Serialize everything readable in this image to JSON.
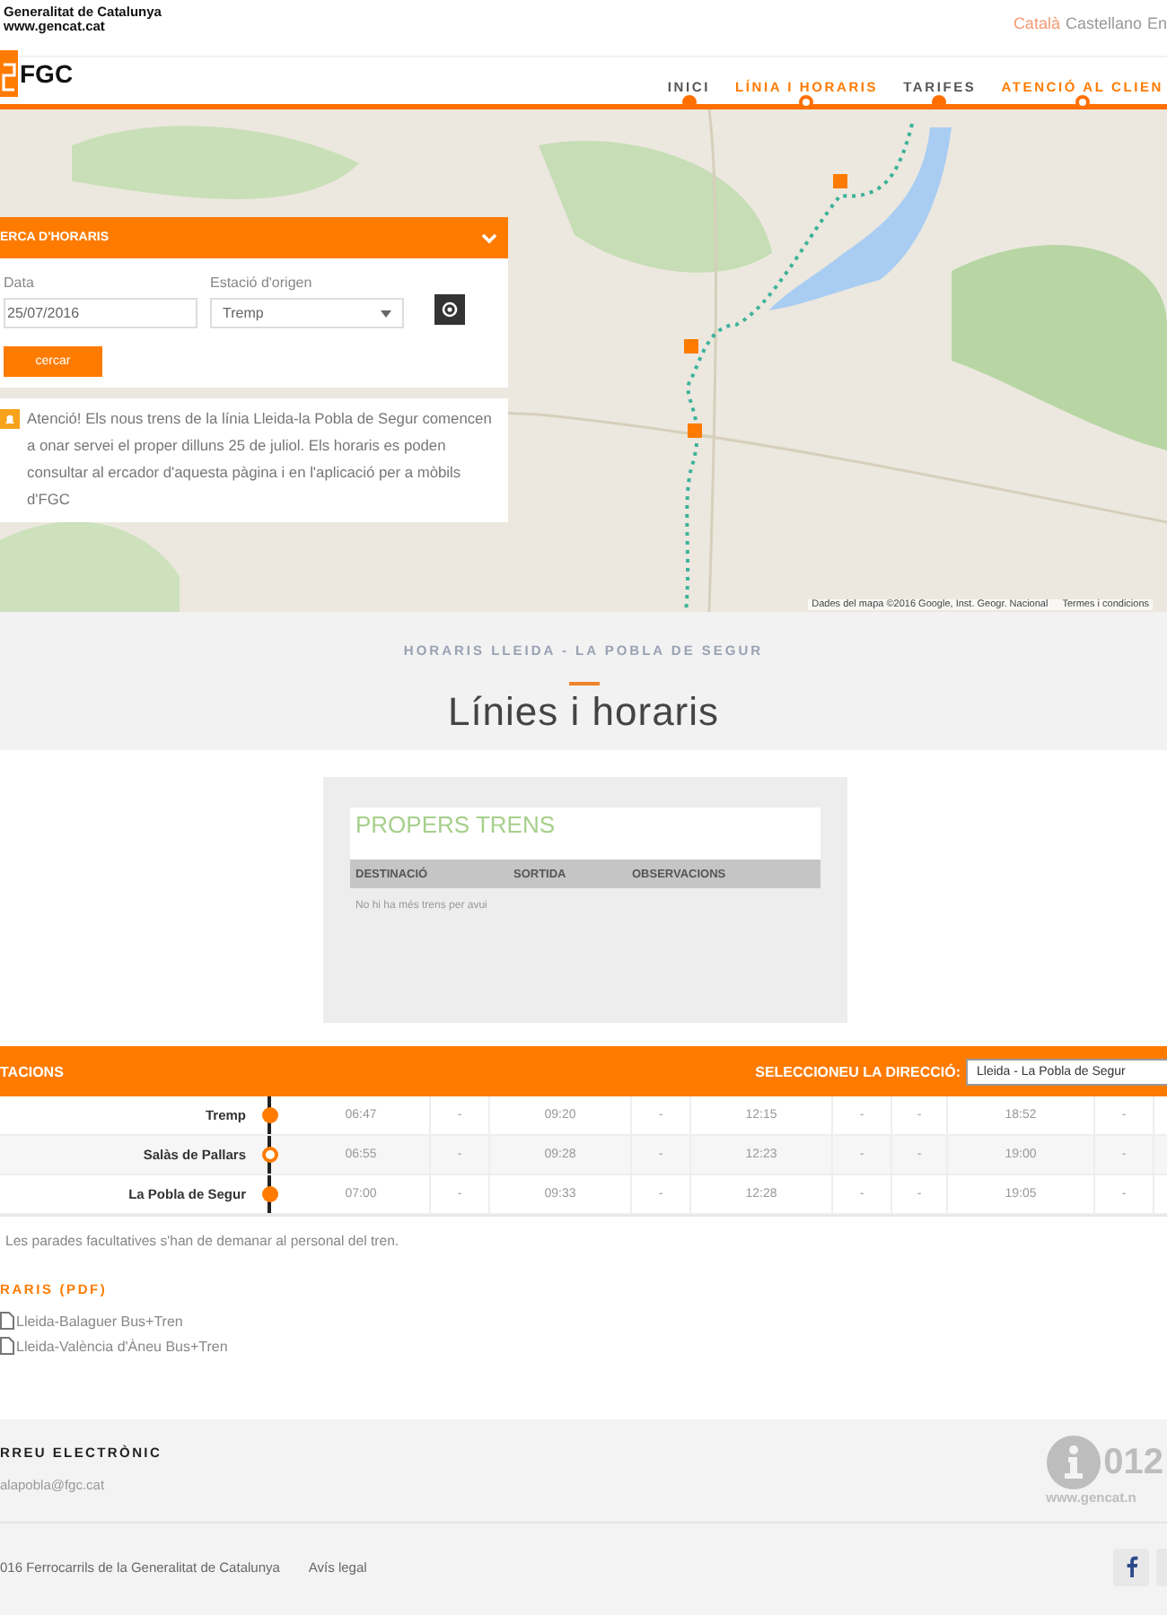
{
  "top_bar": {
    "gov_name": "Generalitat de Catalunya",
    "gov_url": "www.gencat.cat",
    "languages": [
      {
        "label": "Català",
        "selected": true
      },
      {
        "label": "Castellano",
        "selected": false
      },
      {
        "label": "En",
        "selected": false
      }
    ]
  },
  "header": {
    "logo_text": "FGC",
    "nav": [
      {
        "label": "INICI",
        "highlighted": false,
        "dot_filled": true
      },
      {
        "label": "LÍNIA I HORARIS",
        "highlighted": true,
        "dot_filled": false
      },
      {
        "label": "TARIFES",
        "highlighted": false,
        "dot_filled": true
      },
      {
        "label": "ATENCIÓ AL CLIEN",
        "highlighted": true,
        "dot_filled": false
      }
    ]
  },
  "map": {
    "attribution": "Dades del mapa ©2016 Google, Inst. Geogr. Nacional",
    "terms": "Termes i condicions"
  },
  "search_panel": {
    "title": "ERCA D'HORARIS",
    "date_label": "Data",
    "date_value": "25/07/2016",
    "station_label": "Estació d'origen",
    "station_value": "Tremp",
    "submit": "cercar",
    "notice": "Atenció! Els nous trens de la línia Lleida-la Pobla de Segur comencen a onar servei el proper dilluns 25 de juliol. Els horaris es poden consultar al ercador d'aquesta pàgina i en l'aplicació per a mòbils d'FGC"
  },
  "intro": {
    "eyebrow": "HORARIS LLEIDA - LA POBLA DE SEGUR",
    "title": "Línies i horaris"
  },
  "upcoming": {
    "title": "PROPERS TRENS",
    "columns": [
      "DESTINACIÓ",
      "SORTIDA",
      "OBSERVACIONS"
    ],
    "empty_message": "No hi ha més trens per avui"
  },
  "timetable": {
    "header_label": "TACIONS",
    "direction_label": "SELECCIONEU LA DIRECCIÓ:",
    "direction_value": "Lleida - La Pobla de Segur",
    "rows": [
      {
        "station": "Tremp",
        "optional": false,
        "times": [
          "06:47",
          "-",
          "09:20",
          "-",
          "12:15",
          "-",
          "-",
          "18:52",
          "-"
        ]
      },
      {
        "station": "Salàs de Pallars",
        "optional": true,
        "times": [
          "06:55",
          "-",
          "09:28",
          "-",
          "12:23",
          "-",
          "-",
          "19:00",
          "-"
        ]
      },
      {
        "station": "La Pobla de Segur",
        "optional": false,
        "times": [
          "07:00",
          "-",
          "09:33",
          "-",
          "12:28",
          "-",
          "-",
          "19:05",
          "-"
        ]
      }
    ],
    "note": "Les parades facultatives s'han de demanar al personal del tren."
  },
  "pdf_section": {
    "title": "RARIS (PDF)",
    "links": [
      "Lleida-Balaguer Bus+Tren",
      "Lleida-València d'Àneu Bus+Tren"
    ]
  },
  "footer": {
    "email_title": "RREU ELECTRÒNIC",
    "email": "alapobla@fgc.cat",
    "info_number": "012",
    "info_url": "www.gencat.n",
    "copyright": "016 Ferrocarrils de la Generalitat de Catalunya",
    "legal_link": "Avís legal"
  }
}
